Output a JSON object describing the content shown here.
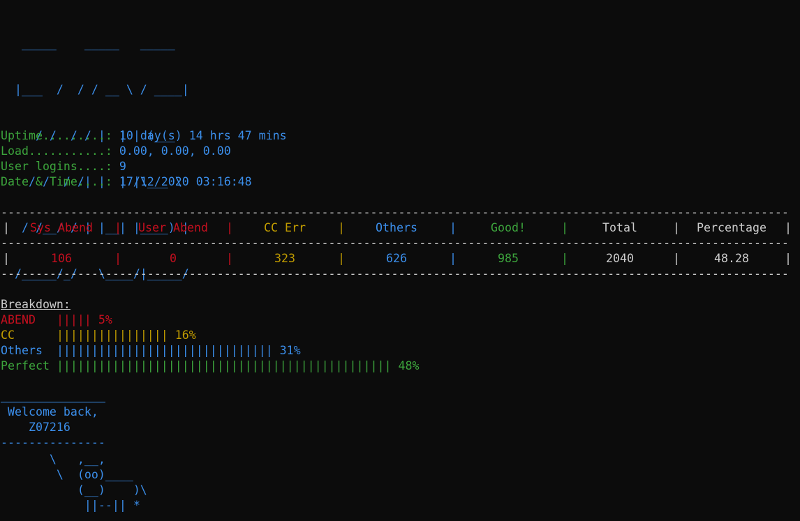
{
  "logo": {
    "lines": [
      "   _____    _____   _____",
      "  |___  /  / / __ \\ / ____|",
      "     / /  / / |  | | (___",
      "    / /  / /| |  | |\\___ \\",
      "   / /__/ / | |__| |____) |",
      "  /_____/_/   \\____/|_____/"
    ]
  },
  "stats": [
    {
      "label": "Uptime.........: ",
      "value": "10 day(s) 14 hrs 47 mins"
    },
    {
      "label": "Load...........: ",
      "value": "0.00, 0.00, 0.00"
    },
    {
      "label": "User logins....: ",
      "value": "9"
    },
    {
      "label": "Date & Time....: ",
      "value": "17/12/2020 03:16:48"
    }
  ],
  "divider": "-----------------------------------------------------------------------------------------------------------------",
  "table": {
    "headers": [
      "Sys Abend",
      "User Abend",
      "CC Err",
      "Others",
      "Good!",
      "Total",
      "Percentage"
    ],
    "values": [
      "106",
      "0",
      "323",
      "626",
      "985",
      "2040",
      "48.28"
    ],
    "colors": [
      "#c50f1f",
      "#c50f1f",
      "#c19c00",
      "#3b8eea",
      "#3ca43c",
      "#cccccc",
      "#cccccc"
    ],
    "pipe": "|"
  },
  "breakdown": {
    "title": "Breakdown:",
    "rows": [
      {
        "label": "ABEND   ",
        "bars": "|||||",
        "pct": "5%",
        "color": "#c50f1f"
      },
      {
        "label": "CC      ",
        "bars": "||||||||||||||||",
        "pct": "16%",
        "color": "#c19c00"
      },
      {
        "label": "Others  ",
        "bars": "|||||||||||||||||||||||||||||||",
        "pct": "31%",
        "color": "#3b8eea"
      },
      {
        "label": "Perfect ",
        "bars": "||||||||||||||||||||||||||||||||||||||||||||||||",
        "pct": "48%",
        "color": "#3ca43c"
      }
    ]
  },
  "welcome": {
    "greeting": " Welcome back,",
    "user": "    Z07216",
    "rule": "---------------"
  },
  "cow": {
    "lines": [
      "       \\   ,__,",
      "        \\  (oo)____",
      "           (__)    )\\",
      "            ||--|| *"
    ]
  }
}
